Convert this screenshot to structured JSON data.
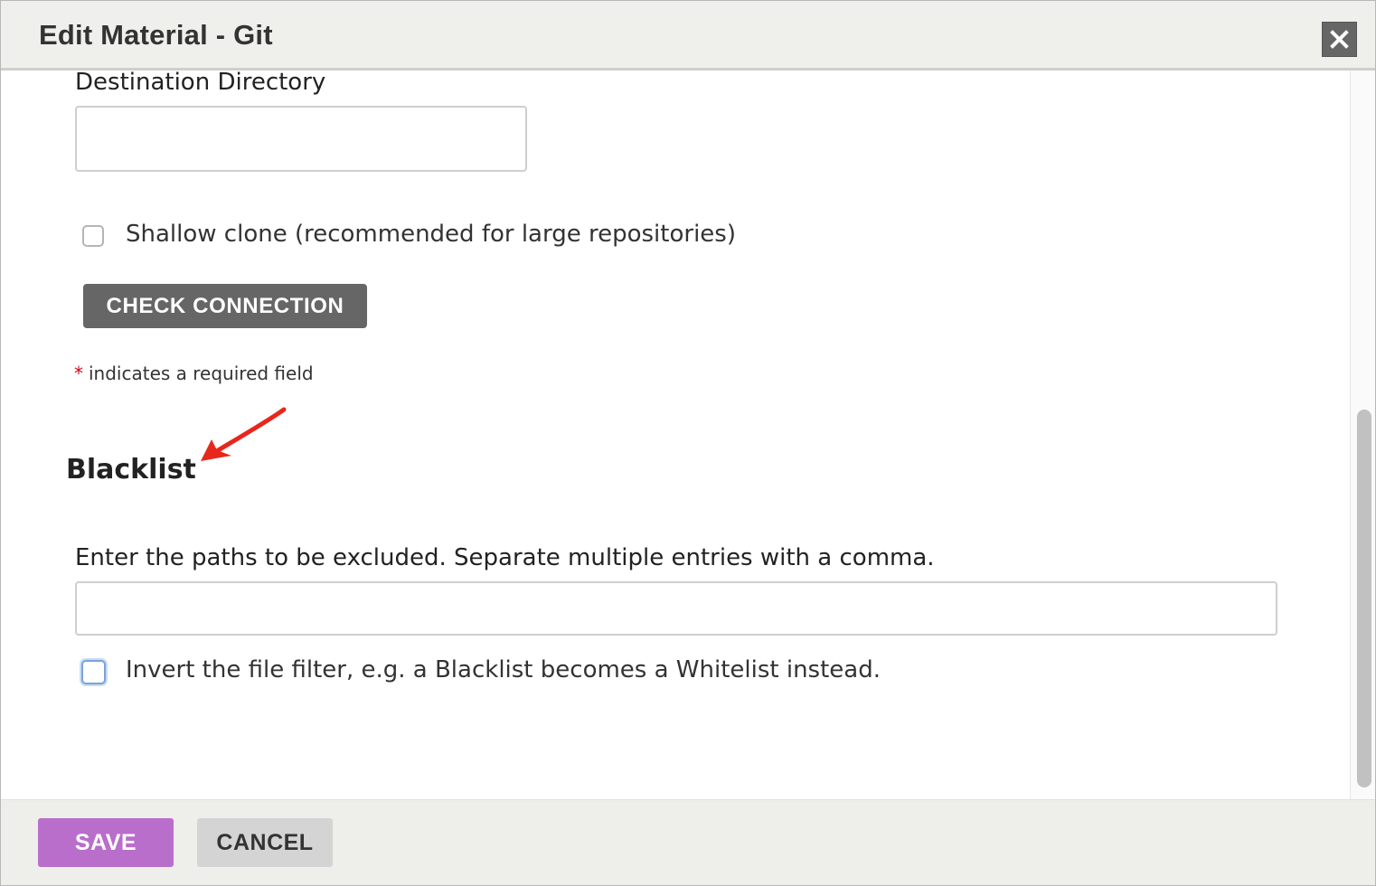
{
  "dialog": {
    "title": "Edit Material - Git",
    "close_icon": "close-icon"
  },
  "form": {
    "destination_directory": {
      "label": "Destination Directory",
      "value": ""
    },
    "shallow_clone": {
      "label": "Shallow clone (recommended for large repositories)",
      "checked": false
    },
    "check_connection_label": "CHECK CONNECTION",
    "required_note": {
      "star": "*",
      "text": "indicates a required field"
    }
  },
  "blacklist": {
    "heading": "Blacklist",
    "annotation_icon": "red-arrow-annotation",
    "paths_label": "Enter the paths to be excluded. Separate multiple entries with a comma.",
    "paths_value": "",
    "invert_filter": {
      "label": "Invert the file filter, e.g. a Blacklist becomes a Whitelist instead.",
      "checked": false
    }
  },
  "footer": {
    "save_label": "SAVE",
    "cancel_label": "CANCEL"
  },
  "colors": {
    "save_button": "#b96ecb",
    "check_connection_button": "#666666",
    "required_star": "#d0021b",
    "annotation_arrow": "#e8271c"
  }
}
